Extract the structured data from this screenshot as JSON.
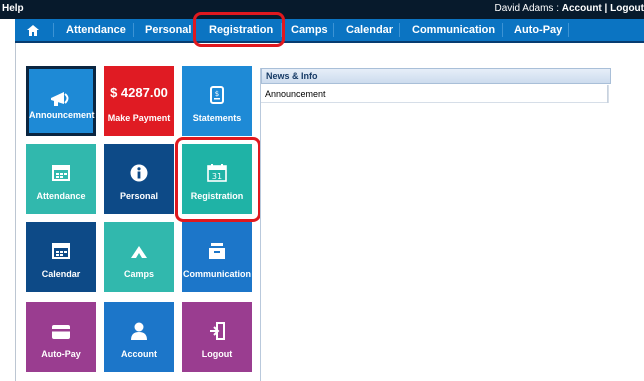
{
  "topbar": {
    "help": "Help",
    "user_name": "David Adams",
    "user_sep": " : ",
    "account": "Account",
    "pipe": " | ",
    "logout": "Logout"
  },
  "nav": {
    "items": [
      "Attendance",
      "Personal",
      "Registration",
      "Camps",
      "Calendar",
      "Communication",
      "Auto-Pay"
    ],
    "home_icon": "home-icon"
  },
  "tiles": [
    {
      "label": "Announcement",
      "icon": "megaphone-icon",
      "color": "#1e8ad6"
    },
    {
      "label": "Make Payment",
      "amount": "$ 4287.00",
      "color": "#e01b23"
    },
    {
      "label": "Statements",
      "icon": "statement-icon",
      "color": "#1e8ad6"
    },
    {
      "label": "Attendance",
      "icon": "attendance-icon",
      "color": "#31b8ad"
    },
    {
      "label": "Personal",
      "icon": "info-icon",
      "color": "#0d4a87"
    },
    {
      "label": "Registration",
      "icon": "calendar-31-icon",
      "color": "#1fb3a6"
    },
    {
      "label": "Calendar",
      "icon": "calendar-icon",
      "color": "#0d4a87"
    },
    {
      "label": "Camps",
      "icon": "tent-icon",
      "color": "#31b8ad"
    },
    {
      "label": "Communication",
      "icon": "inbox-icon",
      "color": "#1c76c9"
    },
    {
      "label": "Auto-Pay",
      "icon": "card-icon",
      "color": "#9a3d90"
    },
    {
      "label": "Account",
      "icon": "user-icon",
      "color": "#1c76c9"
    },
    {
      "label": "Logout",
      "icon": "logout-icon",
      "color": "#9a3d90"
    }
  ],
  "news": {
    "title": "News & Info",
    "rows": [
      "Announcement"
    ]
  },
  "colors": {
    "topbar": "#071a2c",
    "nav": "#0b74c2",
    "highlight": "#e0181e"
  }
}
